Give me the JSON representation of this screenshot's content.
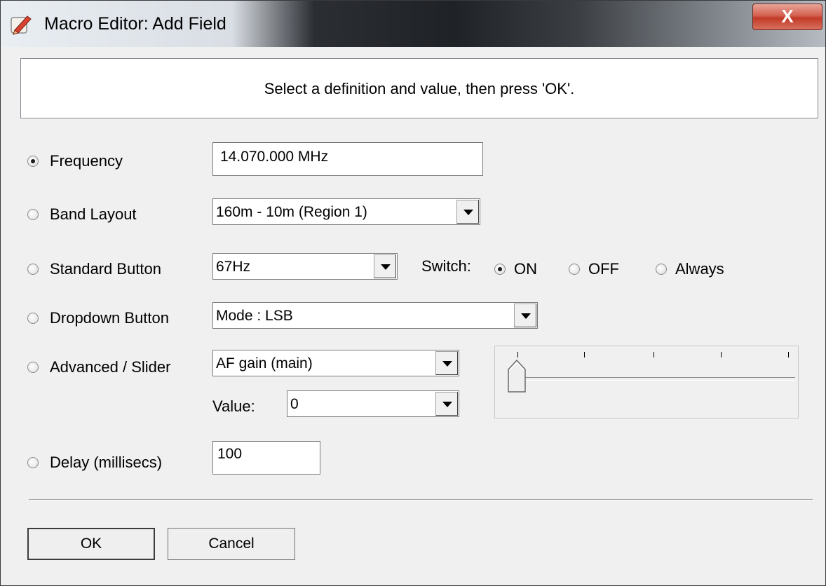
{
  "window": {
    "title": "Macro Editor: Add Field",
    "close_label": "X"
  },
  "message": "Select a definition and value, then press 'OK'.",
  "fields": {
    "frequency": {
      "label": "Frequency",
      "value": "14.070.000 MHz",
      "checked": true
    },
    "band_layout": {
      "label": "Band Layout",
      "value": "160m - 10m (Region 1)",
      "checked": false
    },
    "standard_button": {
      "label": "Standard Button",
      "value": "67Hz",
      "checked": false,
      "switch_label": "Switch:",
      "switch_options": [
        "ON",
        "OFF",
        "Always"
      ],
      "switch_selected": "ON"
    },
    "dropdown_button": {
      "label": "Dropdown Button",
      "value": "Mode : LSB",
      "checked": false
    },
    "advanced_slider": {
      "label": "Advanced / Slider",
      "value": "AF gain (main)",
      "checked": false,
      "value_label": "Value:",
      "value_value": "0",
      "slider_position": 0
    },
    "delay": {
      "label": "Delay (millisecs)",
      "value": "100",
      "checked": false
    }
  },
  "buttons": {
    "ok": "OK",
    "cancel": "Cancel"
  },
  "icons": {
    "app": "macro-editor-icon",
    "combo": "chevron-down-icon"
  }
}
